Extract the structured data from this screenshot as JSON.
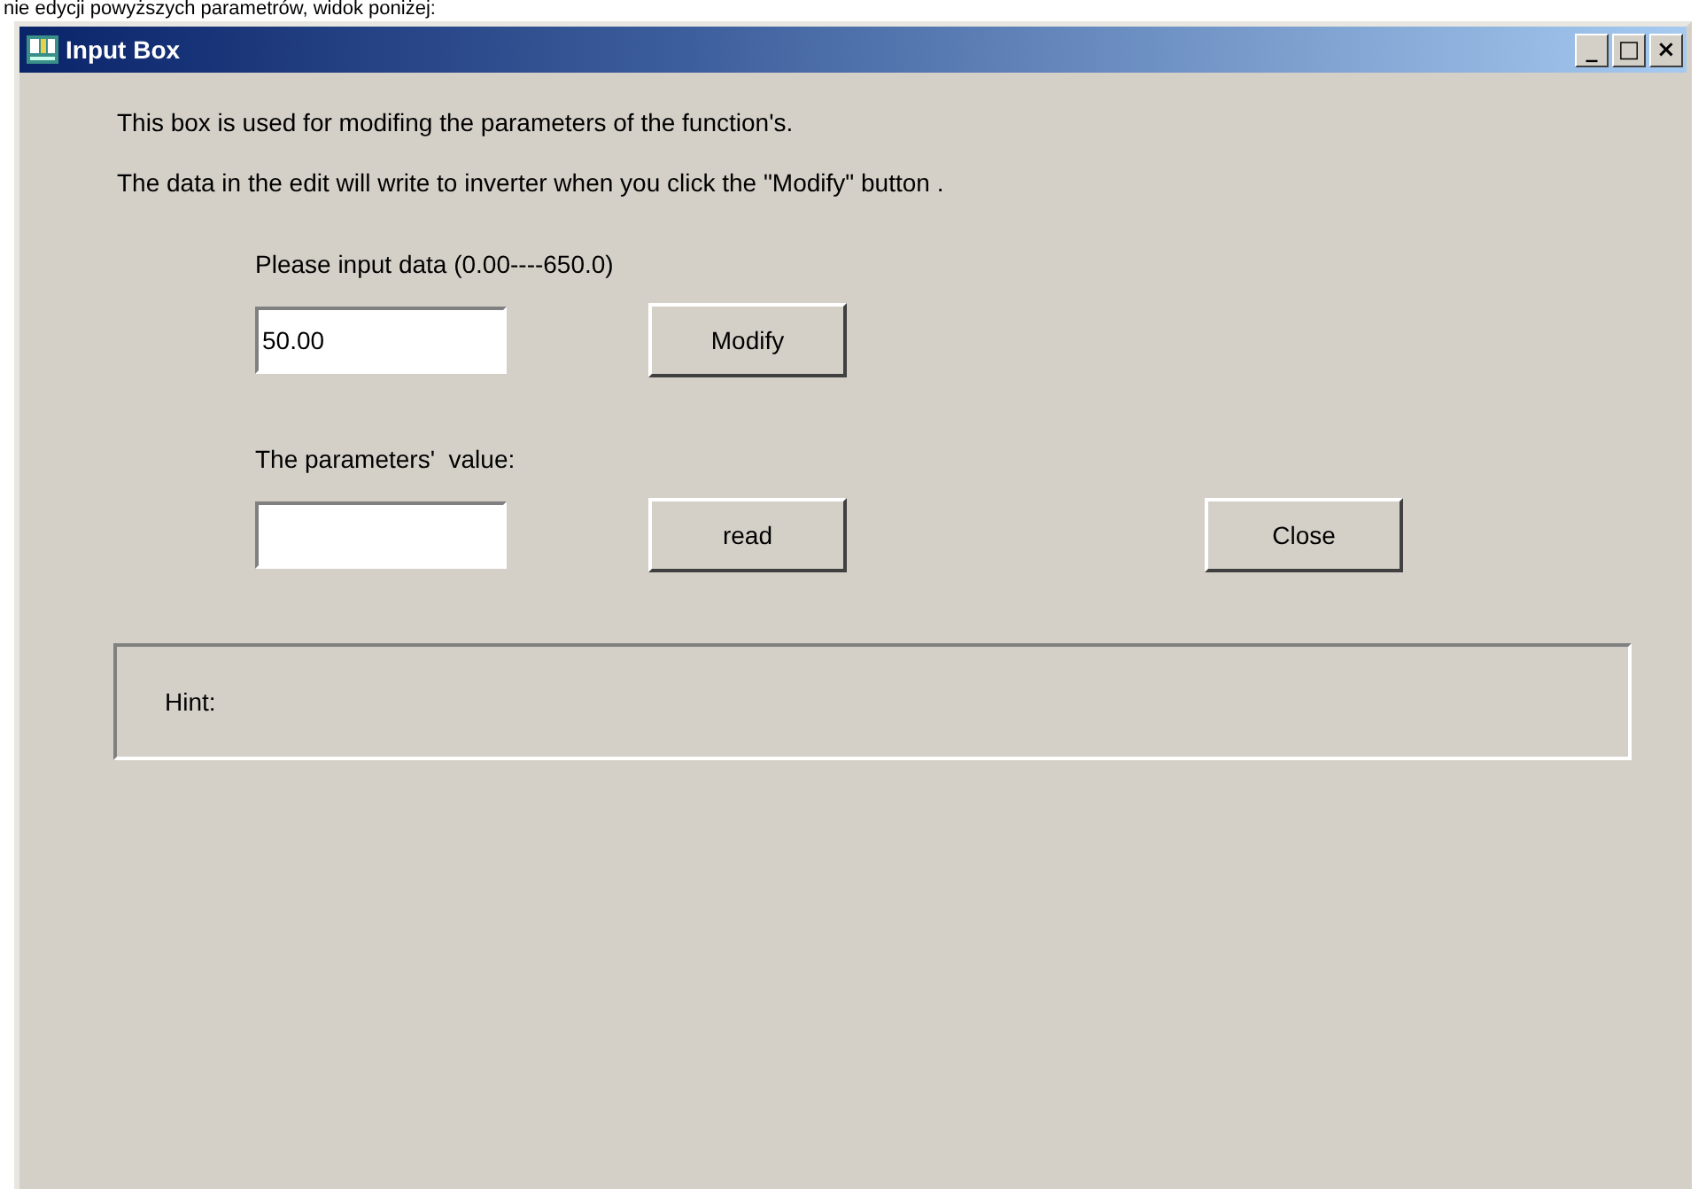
{
  "caption": "nie edycji powyższych parametrów, widok poniżej:",
  "window": {
    "title": "Input Box",
    "controls": [
      "_",
      "□",
      "×"
    ]
  },
  "description": [
    "This box is used for modifing the parameters of the function's.",
    "The data in the edit will write to inverter when you click the \"Modify\" button ."
  ],
  "input_label": "Please input data (0.00----650.0)",
  "input_field": {
    "value": "50.00"
  },
  "modify_button": "Modify",
  "value_label": "The parameters'  value:",
  "read_button": "read",
  "close_button": "Close",
  "hint": "Hint:"
}
